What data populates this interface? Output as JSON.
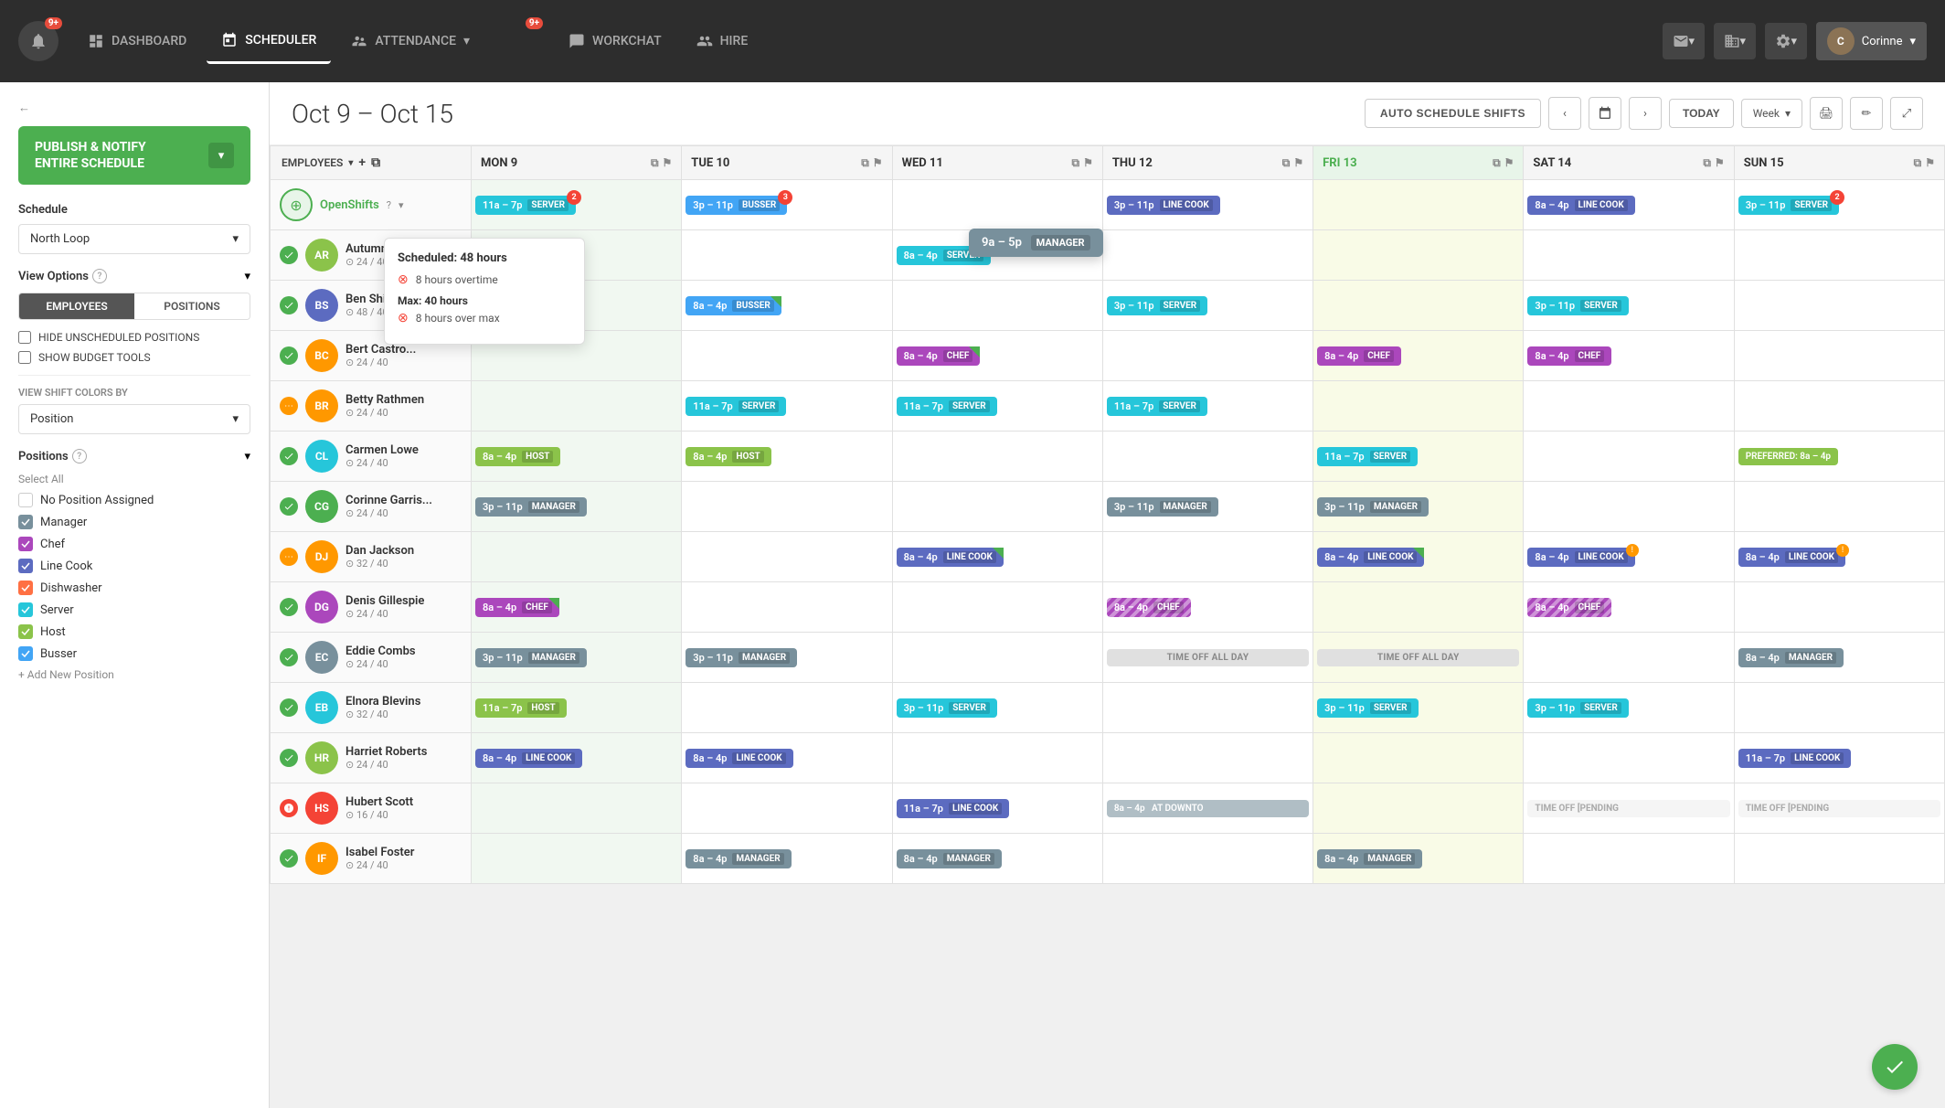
{
  "app": {
    "title": "Scheduler",
    "nav_items": [
      {
        "id": "dashboard",
        "label": "DASHBOARD",
        "active": false
      },
      {
        "id": "scheduler",
        "label": "SCHEDULER",
        "active": true
      },
      {
        "id": "attendance",
        "label": "ATTENDANCE",
        "active": false
      },
      {
        "id": "workchat",
        "label": "WORKCHAT",
        "active": false
      },
      {
        "id": "hire",
        "label": "HIRE",
        "active": false
      }
    ],
    "user": "Corinne",
    "notif_badge": "9+"
  },
  "sidebar": {
    "publish_btn_line1": "PUBLISH & NOTIFY",
    "publish_btn_line2": "ENTIRE SCHEDULE",
    "schedule_label": "Schedule",
    "location": "North Loop",
    "view_options_label": "View Options",
    "tab_employees": "EMPLOYEES",
    "tab_positions": "POSITIONS",
    "hide_unscheduled": "HIDE UNSCHEDULED POSITIONS",
    "show_budget": "SHOW BUDGET TOOLS",
    "view_shift_label": "VIEW SHIFT COLORS BY",
    "shift_color_by": "Position",
    "positions_label": "Positions",
    "select_all": "Select All",
    "positions": [
      {
        "id": "no-position",
        "label": "No Position Assigned",
        "checked": false,
        "color": "#ccc"
      },
      {
        "id": "manager",
        "label": "Manager",
        "checked": true,
        "color": "#78909C"
      },
      {
        "id": "chef",
        "label": "Chef",
        "checked": true,
        "color": "#AB47BC"
      },
      {
        "id": "linecook",
        "label": "Line Cook",
        "checked": true,
        "color": "#5C6BC0"
      },
      {
        "id": "dishwasher",
        "label": "Dishwasher",
        "checked": true,
        "color": "#FF7043"
      },
      {
        "id": "server",
        "label": "Server",
        "checked": true,
        "color": "#26C6DA"
      },
      {
        "id": "host",
        "label": "Host",
        "checked": true,
        "color": "#8BC34A"
      },
      {
        "id": "busser",
        "label": "Busser",
        "checked": true,
        "color": "#42A5F5"
      }
    ],
    "add_position": "+ Add New Position"
  },
  "scheduler": {
    "date_range": "Oct 9 – Oct 15",
    "auto_schedule_btn": "AUTO SCHEDULE SHIFTS",
    "today_btn": "TODAY",
    "week_label": "Week",
    "days": [
      {
        "id": "mon",
        "label": "MON 9",
        "today": false
      },
      {
        "id": "tue",
        "label": "TUE 10",
        "today": false
      },
      {
        "id": "wed",
        "label": "WED 11",
        "today": false
      },
      {
        "id": "thu",
        "label": "THU 12",
        "today": false
      },
      {
        "id": "fri",
        "label": "FRI 13",
        "today": true
      },
      {
        "id": "sat",
        "label": "SAT 14",
        "today": false
      },
      {
        "id": "sun",
        "label": "SUN 15",
        "today": false
      }
    ],
    "employees_col": "EMPLOYEES",
    "open_shifts_label": "OpenShifts",
    "employees": [
      {
        "id": "autumn-ro",
        "name": "Autumn Ro...",
        "hours": "24 / 40",
        "status": "green",
        "avatar_color": "#8BC34A",
        "initials": "AR",
        "shifts": {
          "mon": {
            "time": "11a – 7p",
            "pos": "SERVER",
            "color": "c-server",
            "triangle": "green"
          },
          "tue": null,
          "wed": {
            "time": "8a – 4p",
            "pos": "SERVER",
            "color": "c-server",
            "triangle": "green"
          },
          "thu": null,
          "fri": null,
          "sat": null,
          "sun": null
        }
      },
      {
        "id": "ben-shield",
        "name": "Ben Shield...",
        "hours": "48 / 40",
        "status": "green",
        "avatar_color": "#5C6BC0",
        "initials": "BS",
        "shifts": {
          "mon": {
            "time": "11a – 7p",
            "pos": "SERVER",
            "color": "c-server",
            "triangle": "green"
          },
          "tue": {
            "time": "8a – 4p",
            "pos": "BUSSER",
            "color": "c-busser",
            "triangle": "green"
          },
          "wed": null,
          "thu": {
            "time": "3p – 11p",
            "pos": "SERVER",
            "color": "c-server"
          },
          "fri": null,
          "sat": {
            "time": "3p – 11p",
            "pos": "SERVER",
            "color": "c-server"
          },
          "sun": null
        }
      },
      {
        "id": "bert-castro",
        "name": "Bert Castro...",
        "hours": "24 / 40",
        "status": "green",
        "avatar_color": "#FF9800",
        "initials": "BC",
        "shifts": {
          "mon": null,
          "tue": null,
          "wed": {
            "time": "8a – 4p",
            "pos": "CHEF",
            "color": "c-chef"
          },
          "thu": null,
          "fri": {
            "time": "8a – 4p",
            "pos": "CHEF",
            "color": "c-chef"
          },
          "sat": {
            "time": "8a – 4p",
            "pos": "CHEF",
            "color": "c-chef"
          },
          "sun": null
        }
      },
      {
        "id": "betty-rathmen",
        "name": "Betty Rathmen",
        "hours": "24 / 40",
        "status": "orange",
        "avatar_color": "#FF9800",
        "initials": "BR",
        "shifts": {
          "mon": null,
          "tue": {
            "time": "11a – 7p",
            "pos": "SERVER",
            "color": "c-server"
          },
          "wed": {
            "time": "11a – 7p",
            "pos": "SERVER",
            "color": "c-server"
          },
          "thu": {
            "time": "11a – 7p",
            "pos": "SERVER",
            "color": "c-server"
          },
          "fri": null,
          "sat": null,
          "sun": null
        }
      },
      {
        "id": "carmen-lowe",
        "name": "Carmen Lowe",
        "hours": "24 / 40",
        "status": "green",
        "avatar_color": "#26C6DA",
        "initials": "CL",
        "shifts": {
          "mon": {
            "time": "8a – 4p",
            "pos": "HOST",
            "color": "c-host"
          },
          "tue": {
            "time": "8a – 4p",
            "pos": "HOST",
            "color": "c-host"
          },
          "wed": null,
          "thu": null,
          "fri": {
            "time": "11a – 7p",
            "pos": "SERVER",
            "color": "c-server"
          },
          "sat": null,
          "sun": {
            "time": "PREFERRED: 8a – 4p",
            "pos": "",
            "color": "c-preferred",
            "special": "preferred"
          }
        }
      },
      {
        "id": "corinne-garris",
        "name": "Corinne Garris...",
        "hours": "24 / 40",
        "status": "green",
        "avatar_color": "#4CAF50",
        "initials": "CG",
        "shifts": {
          "mon": {
            "time": "3p – 11p",
            "pos": "MANAGER",
            "color": "c-manager"
          },
          "tue": null,
          "wed": null,
          "thu": {
            "time": "3p – 11p",
            "pos": "MANAGER",
            "color": "c-manager"
          },
          "fri": {
            "time": "3p – 11p",
            "pos": "MANAGER",
            "color": "c-manager"
          },
          "sat": null,
          "sun": null
        }
      },
      {
        "id": "dan-jackson",
        "name": "Dan Jackson",
        "hours": "32 / 40",
        "status": "orange",
        "avatar_color": "#FF9800",
        "initials": "DJ",
        "shifts": {
          "mon": null,
          "tue": null,
          "wed": {
            "time": "8a – 4p",
            "pos": "LINE COOK",
            "color": "c-linecook",
            "check": true
          },
          "thu": null,
          "fri": {
            "time": "8a – 4p",
            "pos": "LINE COOK",
            "color": "c-linecook",
            "check": true
          },
          "sat": {
            "time": "8a – 4p",
            "pos": "LINE COOK",
            "color": "c-linecook",
            "warn": true
          },
          "sun": {
            "time": "8a – 4p",
            "pos": "LINE COOK",
            "color": "c-linecook",
            "warn": true
          }
        }
      },
      {
        "id": "denis-gillespie",
        "name": "Denis Gillespie",
        "hours": "24 / 40",
        "status": "green",
        "avatar_color": "#AB47BC",
        "initials": "DG",
        "shifts": {
          "mon": {
            "time": "8a – 4p",
            "pos": "CHEF",
            "color": "c-chef",
            "triangle": "green"
          },
          "tue": null,
          "wed": null,
          "thu": {
            "time": "8a – 4p",
            "pos": "CHEF",
            "color": "c-chef",
            "striped": true
          },
          "fri": null,
          "sat": {
            "time": "8a – 4p",
            "pos": "CHEF",
            "color": "c-chef",
            "striped": true
          },
          "sun": null
        }
      },
      {
        "id": "eddie-combs",
        "name": "Eddie Combs",
        "hours": "24 / 40",
        "status": "green",
        "avatar_color": "#78909C",
        "initials": "EC",
        "shifts": {
          "mon": {
            "time": "3p – 11p",
            "pos": "MANAGER",
            "color": "c-manager"
          },
          "tue": {
            "time": "3p – 11p",
            "pos": "MANAGER",
            "color": "c-manager"
          },
          "wed": null,
          "thu": {
            "special": "timeoff",
            "label": "TIME OFF ALL DAY"
          },
          "fri": {
            "special": "timeoff",
            "label": "TIME OFF ALL DAY"
          },
          "sat": null,
          "sun": {
            "time": "8a – 4p",
            "pos": "MANAGER",
            "color": "c-manager"
          }
        }
      },
      {
        "id": "elnora-blevins",
        "name": "Elnora Blevins",
        "hours": "32 / 40",
        "status": "green",
        "avatar_color": "#26C6DA",
        "initials": "EB",
        "shifts": {
          "mon": {
            "time": "11a – 7p",
            "pos": "HOST",
            "color": "c-host"
          },
          "tue": null,
          "wed": {
            "time": "3p – 11p",
            "pos": "SERVER",
            "color": "c-server"
          },
          "thu": null,
          "fri": {
            "time": "3p – 11p",
            "pos": "SERVER",
            "color": "c-server"
          },
          "sat": {
            "time": "3p – 11p",
            "pos": "SERVER",
            "color": "c-server"
          },
          "sun": null
        }
      },
      {
        "id": "harriet-roberts",
        "name": "Harriet Roberts",
        "hours": "24 / 40",
        "status": "green",
        "avatar_color": "#8BC34A",
        "initials": "HR",
        "shifts": {
          "mon": {
            "time": "8a – 4p",
            "pos": "LINE COOK",
            "color": "c-linecook"
          },
          "tue": {
            "time": "8a – 4p",
            "pos": "LINE COOK",
            "color": "c-linecook"
          },
          "wed": null,
          "thu": null,
          "fri": null,
          "sat": null,
          "sun": {
            "time": "11a – 7p",
            "pos": "LINE COOK",
            "color": "c-linecook"
          }
        }
      },
      {
        "id": "hubert-scott",
        "name": "Hubert Scott",
        "hours": "16 / 40",
        "status": "red",
        "avatar_color": "#f44336",
        "initials": "HS",
        "shifts": {
          "mon": null,
          "tue": null,
          "wed": {
            "time": "11a – 7p",
            "pos": "LINE COOK",
            "color": "c-linecook"
          },
          "thu": {
            "special": "atdownto",
            "time": "8a – 4p",
            "label": "AT DOWNTO"
          },
          "fri": null,
          "sat": {
            "special": "pending",
            "label": "TIME OFF [PENDING"
          },
          "sun": {
            "special": "pending",
            "label": "TIME OFF [PENDING"
          }
        }
      },
      {
        "id": "isabel-foster",
        "name": "Isabel Foster",
        "hours": "24 / 40",
        "status": "green",
        "avatar_color": "#FF9800",
        "initials": "IF",
        "shifts": {
          "mon": null,
          "tue": {
            "time": "8a – 4p",
            "pos": "MANAGER",
            "color": "c-manager"
          },
          "wed": {
            "time": "8a – 4p",
            "pos": "MANAGER",
            "color": "c-manager"
          },
          "thu": null,
          "fri": {
            "time": "8a – 4p",
            "pos": "MANAGER",
            "color": "c-manager"
          },
          "sat": null,
          "sun": null
        }
      }
    ],
    "open_shifts": {
      "mon": {
        "time": "11a – 7p",
        "pos": "SERVER",
        "color": "c-server",
        "badge": "2"
      },
      "tue": {
        "time": "3p – 11p",
        "pos": "BUSSER",
        "color": "c-busser",
        "badge": "3"
      },
      "wed": null,
      "thu": {
        "time": "3p – 11p",
        "pos": "LINE COOK",
        "color": "c-linecook"
      },
      "fri": null,
      "sat": {
        "time": "8a – 4p",
        "pos": "LINE COOK",
        "color": "c-linecook"
      },
      "sun": {
        "time": "3p – 11p",
        "pos": "SERVER",
        "color": "c-server",
        "badge": "2"
      }
    }
  },
  "tooltip": {
    "title": "Scheduled: 48 hours",
    "overtime_label": "8 hours overtime",
    "max_title": "Max: 40 hours",
    "max_label": "8 hours over max"
  },
  "manager_tooltip": {
    "time": "9a – 5p",
    "pos": "MANAGER"
  }
}
